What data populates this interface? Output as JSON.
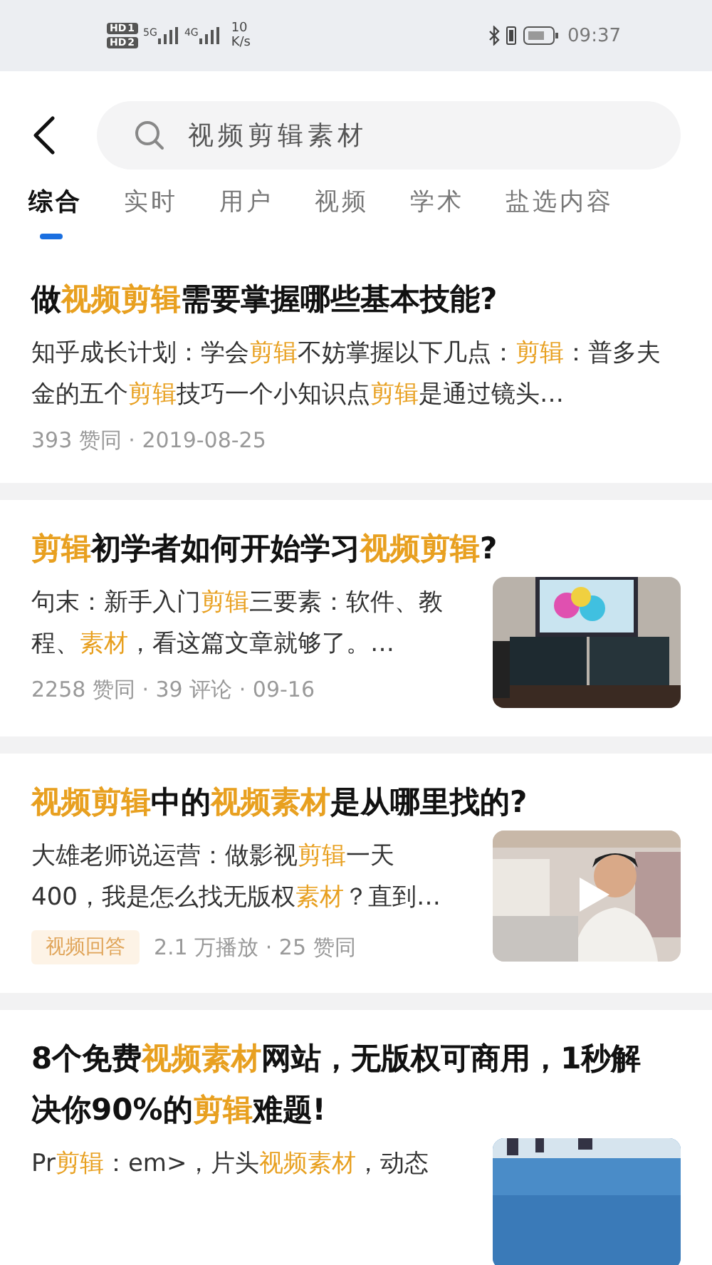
{
  "status_bar": {
    "sims": [
      {
        "label": "HD",
        "slot": "1"
      },
      {
        "label": "HD",
        "slot": "2"
      }
    ],
    "networks": [
      "5G",
      "4G"
    ],
    "speed": [
      "10",
      "K/s"
    ],
    "time": "09:37"
  },
  "search": {
    "value": "视频剪辑素材"
  },
  "tabs": [
    {
      "label": "综合",
      "selected": true
    },
    {
      "label": "实时",
      "selected": false
    },
    {
      "label": "用户",
      "selected": false
    },
    {
      "label": "视频",
      "selected": false
    },
    {
      "label": "学术",
      "selected": false
    },
    {
      "label": "盐选内容",
      "selected": false
    }
  ],
  "results": [
    {
      "title": [
        {
          "t": "做",
          "hl": false
        },
        {
          "t": "视频剪辑",
          "hl": true
        },
        {
          "t": "需要掌握哪些基本技能?",
          "hl": false
        }
      ],
      "snippet": [
        {
          "t": "知乎成长计划：学会",
          "hl": false
        },
        {
          "t": "剪辑",
          "hl": true
        },
        {
          "t": "不妨掌握以下几点：",
          "hl": false
        },
        {
          "t": "剪辑",
          "hl": true
        },
        {
          "t": "：普多夫金的五个",
          "hl": false
        },
        {
          "t": "剪辑",
          "hl": true
        },
        {
          "t": "技巧一个小知识点",
          "hl": false
        },
        {
          "t": "剪辑",
          "hl": true
        },
        {
          "t": "是通过镜头…",
          "hl": false
        }
      ],
      "meta": "393 赞同 · 2019-08-25"
    },
    {
      "title": [
        {
          "t": "剪辑",
          "hl": true
        },
        {
          "t": "初学者如何开始学习",
          "hl": false
        },
        {
          "t": "视频剪辑",
          "hl": true
        },
        {
          "t": "?",
          "hl": false
        }
      ],
      "snippet": [
        {
          "t": "句末：新手入门",
          "hl": false
        },
        {
          "t": "剪辑",
          "hl": true
        },
        {
          "t": "三要素：软件、教程、",
          "hl": false
        },
        {
          "t": "素材",
          "hl": true
        },
        {
          "t": "，看这篇文章就够了。…",
          "hl": false
        }
      ],
      "meta": "2258 赞同 · 39 评论 · 09-16",
      "thumbnail": {
        "kind": "picture"
      }
    },
    {
      "title": [
        {
          "t": "视频剪辑",
          "hl": true
        },
        {
          "t": "中的",
          "hl": false
        },
        {
          "t": "视频素材",
          "hl": true
        },
        {
          "t": "是从哪里找的?",
          "hl": false
        }
      ],
      "snippet": [
        {
          "t": "大雄老师说运营：做影视",
          "hl": false
        },
        {
          "t": "剪辑",
          "hl": true
        },
        {
          "t": "一天400，我是怎么找无版权",
          "hl": false
        },
        {
          "t": "素材",
          "hl": true
        },
        {
          "t": "？直到…",
          "hl": false
        }
      ],
      "tag": "视频回答",
      "meta": "2.1 万播放 · 25 赞同",
      "thumbnail": {
        "kind": "picture",
        "play": true
      }
    },
    {
      "title": [
        {
          "t": "8个免费",
          "hl": false
        },
        {
          "t": "视频素材",
          "hl": true
        },
        {
          "t": "网站，无版权可商用，1秒解决你90%的",
          "hl": false
        },
        {
          "t": "剪辑",
          "hl": true
        },
        {
          "t": "难题!",
          "hl": false
        }
      ],
      "snippet": [
        {
          "t": "Pr",
          "hl": false
        },
        {
          "t": "剪辑",
          "hl": true
        },
        {
          "t": "：em>，片头",
          "hl": false
        },
        {
          "t": "视频素材",
          "hl": true
        },
        {
          "t": "，动态",
          "hl": false
        }
      ],
      "thumbnail": {
        "kind": "picture"
      }
    }
  ]
}
